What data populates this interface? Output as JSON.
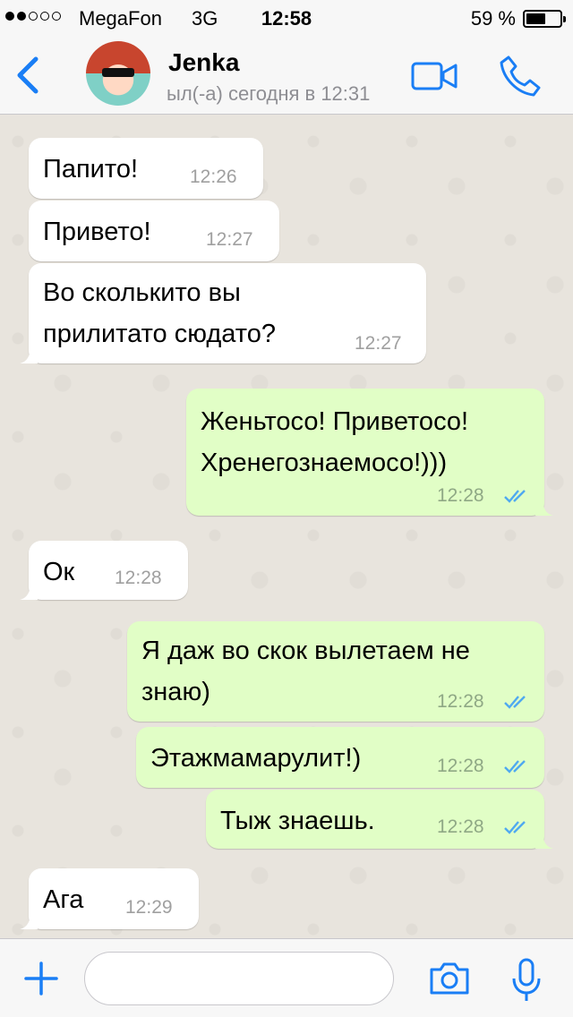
{
  "status_bar": {
    "signal_dots_filled": 2,
    "signal_dots_total": 5,
    "carrier": "MegaFon",
    "network": "3G",
    "time": "12:58",
    "battery": "59 %",
    "battery_level": 0.59
  },
  "header": {
    "back_icon": "chevron-left-icon",
    "contact_name": "Jenka",
    "last_seen": "ыл(-а) сегодня в 12:31",
    "video_icon": "video-camera-icon",
    "call_icon": "phone-icon"
  },
  "messages": [
    {
      "direction": "in",
      "text": "Папито!",
      "time": "12:26"
    },
    {
      "direction": "in",
      "text": "Привето!",
      "time": "12:27"
    },
    {
      "direction": "in",
      "lines": [
        "Во сколькито вы",
        "прилитато сюдато?"
      ],
      "time": "12:27"
    },
    {
      "direction": "out",
      "lines": [
        "Женьтосо! Приветосо!",
        "Хренегознаемосо!)))"
      ],
      "time": "12:28",
      "status": "read"
    },
    {
      "direction": "in",
      "text": "Ок",
      "time": "12:28"
    },
    {
      "direction": "out",
      "lines": [
        "Я даж во скок вылетаем не",
        "знаю)"
      ],
      "time": "12:28",
      "status": "read"
    },
    {
      "direction": "out",
      "text": "Этажмамарулит!)",
      "time": "12:28",
      "status": "read"
    },
    {
      "direction": "out",
      "text": "Тыж знаешь.",
      "time": "12:28",
      "status": "read"
    },
    {
      "direction": "in",
      "text": "Ага",
      "time": "12:29"
    }
  ],
  "input_bar": {
    "plus_icon": "plus-icon",
    "message_value": "",
    "camera_icon": "camera-icon",
    "mic_icon": "microphone-icon"
  },
  "colors": {
    "accent": "#1a7ef5",
    "incoming_bubble": "#ffffff",
    "outgoing_bubble": "#e1fec6",
    "read_ticks": "#4fa9f0",
    "chat_background": "#e8e4dd"
  }
}
